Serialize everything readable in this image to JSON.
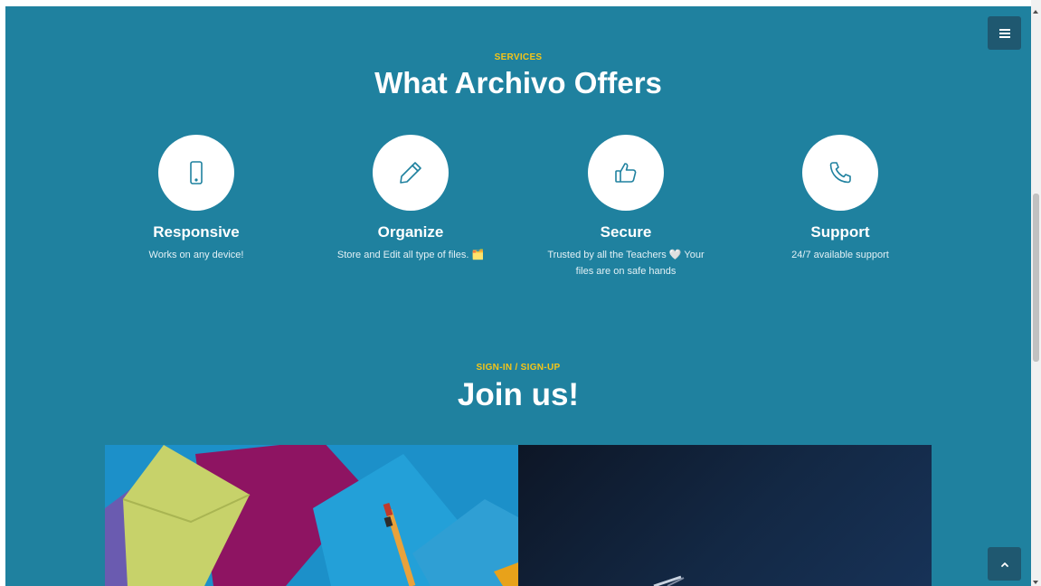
{
  "services": {
    "eyebrow": "SERVICES",
    "title": "What Archivo Offers",
    "items": [
      {
        "name": "Responsive",
        "desc": "Works on any device!",
        "icon": "phone-icon"
      },
      {
        "name": "Organize",
        "desc": "Store and Edit all type of files. 🗂️",
        "icon": "pencil-icon"
      },
      {
        "name": "Secure",
        "desc": "Trusted by all the Teachers 🤍 Your files are on safe hands",
        "icon": "thumbs-up-icon"
      },
      {
        "name": "Support",
        "desc": "24/7 available support",
        "icon": "telephone-icon"
      }
    ]
  },
  "join": {
    "eyebrow": "SIGN-IN / SIGN-UP",
    "title": "Join us!"
  },
  "colors": {
    "background": "#1f819f",
    "accent": "#f5c518",
    "icon_stroke": "#1f819f",
    "button": "#1f5870"
  },
  "controls": {
    "menu_icon": "hamburger-menu-icon",
    "back_to_top_icon": "chevron-up-icon"
  }
}
